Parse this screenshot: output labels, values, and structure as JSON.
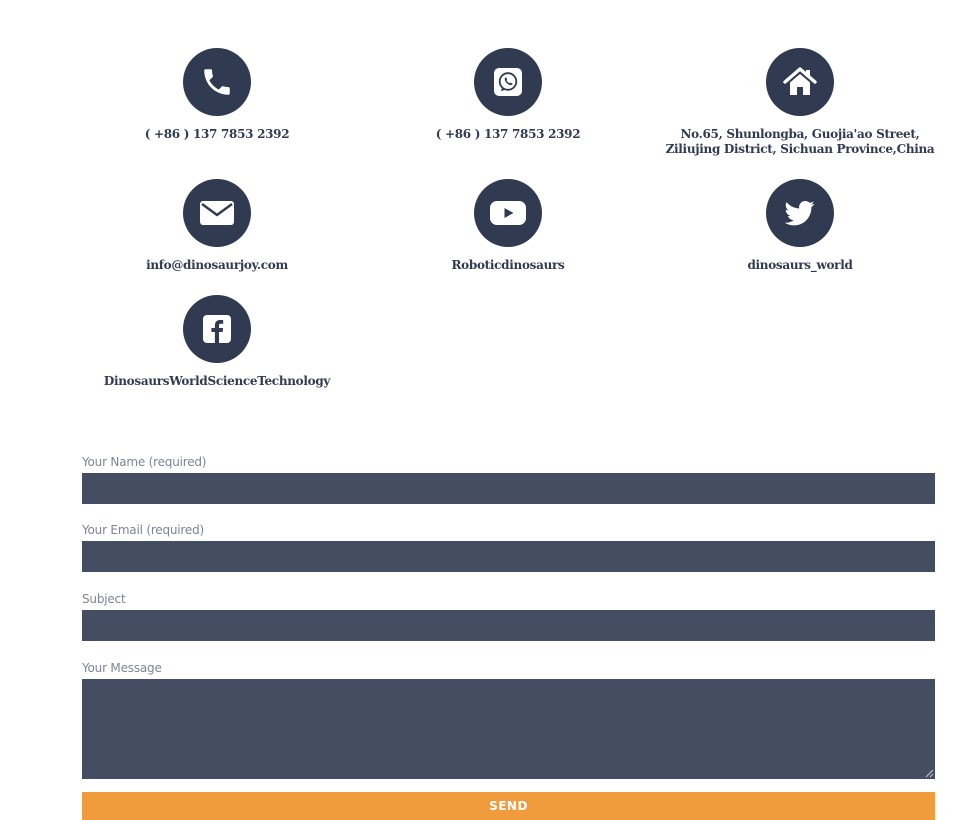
{
  "contacts": {
    "phone": {
      "text": "( +86 ) 137 7853 2392",
      "icon": "phone-icon"
    },
    "whatsapp": {
      "text": "( +86 ) 137 7853 2392",
      "icon": "whatsapp-icon"
    },
    "address": {
      "text": "No.65, Shunlongba, Guojia'ao Street, Ziliujing District, Sichuan Province,China",
      "icon": "home-icon"
    },
    "email": {
      "text": "info@dinosaurjoy.com",
      "icon": "envelope-icon"
    },
    "youtube": {
      "text": "Roboticdinosaurs",
      "icon": "youtube-icon"
    },
    "twitter": {
      "text": "dinosaurs_world",
      "icon": "twitter-icon"
    },
    "facebook": {
      "text": "DinosaursWorldScienceTechnology",
      "icon": "facebook-icon"
    }
  },
  "form": {
    "name_label": "Your Name (required)",
    "name_value": "",
    "email_label": "Your Email (required)",
    "email_value": "",
    "subject_label": "Subject",
    "subject_value": "",
    "message_label": "Your Message",
    "message_value": "",
    "send_label": "SEND"
  },
  "colors": {
    "icon_circle": "#303a50",
    "field_background": "#444d62",
    "button_background": "#f09c3c",
    "label_text": "#7d8494"
  }
}
